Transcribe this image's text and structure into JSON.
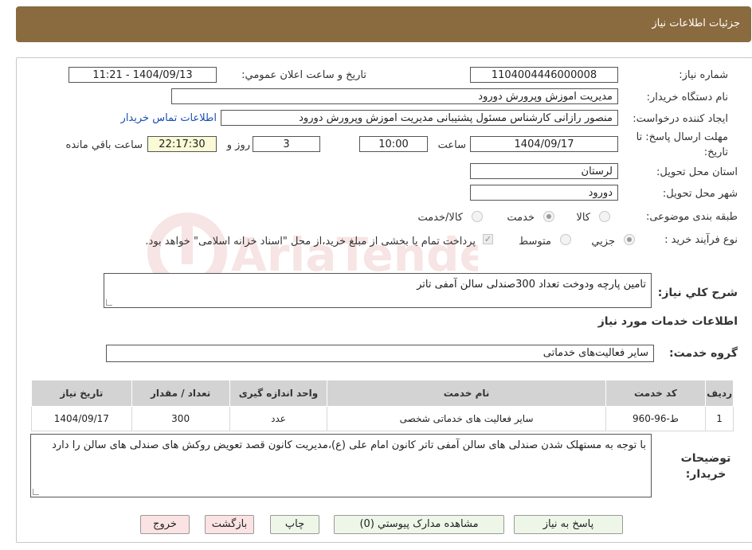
{
  "header": {
    "title": "جزئیات اطلاعات نیاز"
  },
  "watermark": {
    "text": "AriaTender.neT"
  },
  "fields": {
    "need_number_label": "شماره نیاز:",
    "need_number": "1104004446000008",
    "announce_label": "تاریخ و ساعت اعلان عمومي:",
    "announce_value": "1404/09/13 - 11:21",
    "buyer_org_label": "نام دستگاه خريدار:",
    "buyer_org": "مديريت اموزش وپرورش دورود",
    "requester_label": "ايجاد کننده درخواست:",
    "requester": "منصور رازانی کارشناس مسئول پشتیبانی مدیریت اموزش وپرورش دورود",
    "contact_link": "اطلاعات تماس خريدار",
    "deadline_label_1": "مهلت ارسال پاسخ: تا",
    "deadline_label_2": "تاریخ:",
    "deadline_date": "1404/09/17",
    "time_label": "ساعت",
    "deadline_time": "10:00",
    "days_value": "3",
    "days_label": "روز و",
    "remaining_time": "22:17:30",
    "remaining_label": "ساعت باقي مانده",
    "province_label": "استان محل تحویل:",
    "province": "لرستان",
    "city_label": "شهر محل تحویل:",
    "city": "دورود",
    "category_label": "طبقه بندی موضوعی:",
    "category_options": [
      "کالا",
      "خدمت",
      "کالا/خدمت"
    ],
    "category_selected": "خدمت",
    "process_label": "نوع فرآیند خرید :",
    "process_options": [
      "جزيي",
      "متوسط"
    ],
    "process_selected": "جزيي",
    "payment_note": "پرداخت تمام یا بخشی از مبلغ خرید،از محل \"اسناد خزانه اسلامی\" خواهد بود.",
    "summary_label": "شرح کلي نياز:",
    "summary": "تامین پارچه ودوخت تعداد 300صندلی سالن آمفی تاتر",
    "services_title": "اطلاعات خدمات مورد نياز",
    "service_group_label": "گروه خدمت:",
    "service_group": "ساير فعاليت‌هاى خدماتى",
    "notes_label": "توضيحات خريدار:",
    "notes": "با توجه به مستهلک شدن صندلی های سالن آمفی تاتر کانون امام علی (ع)،مدیریت کانون قصد تعویض روکش های صندلی های سالن را دارد"
  },
  "table": {
    "headers": [
      "رديف",
      "کد خدمت",
      "نام خدمت",
      "واحد اندازه گيری",
      "تعداد / مقدار",
      "تاریخ نیاز"
    ],
    "rows": [
      [
        "1",
        "ط-96-960",
        "ساير فعاليت هاى خدماتى شخصى",
        "عدد",
        "300",
        "1404/09/17"
      ]
    ]
  },
  "buttons": {
    "reply": "پاسخ به نياز",
    "attachments": "مشاهده مدارک پيوستي (0)",
    "print": "چاپ",
    "back": "بازگشت",
    "exit": "خروج"
  }
}
